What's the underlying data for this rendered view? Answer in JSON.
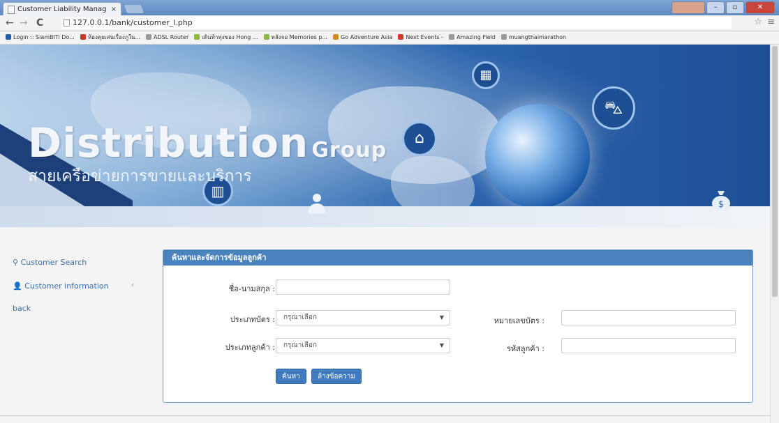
{
  "browser": {
    "tab_title": "Customer Liability Manag",
    "tab_close": "×",
    "url": "127.0.0.1/bank/customer_l.php",
    "bookmarks": [
      {
        "label": "Login :: SiamBITi Do...",
        "color": "#2a5db0"
      },
      {
        "label": "ห้องคุยเล่นเรื่องภูใน...",
        "color": "#c0392b"
      },
      {
        "label": "ADSL Router",
        "color": "#999999"
      },
      {
        "label": "เดินท้าทุ่งของ Hong ...",
        "color": "#8ab73c"
      },
      {
        "label": "หลังจอ Memories p...",
        "color": "#8ab73c"
      },
      {
        "label": "Go Adventure Asia",
        "color": "#d68a1c"
      },
      {
        "label": "Next Events -",
        "color": "#d63a2a"
      },
      {
        "label": "Amazing Field",
        "color": "#999999"
      },
      {
        "label": "muangthaimarathon",
        "color": "#999999"
      }
    ]
  },
  "banner": {
    "title": "Distribution",
    "title_suffix": "Group",
    "subtitle": "สายเครือข่ายการขายและบริการ"
  },
  "sidebar": {
    "items": [
      {
        "label": "Customer Search",
        "icon": "search-icon"
      },
      {
        "label": "Customer information",
        "icon": "user-icon"
      },
      {
        "label": "back"
      }
    ]
  },
  "panel": {
    "title": "ค้นหาและจัดการข้อมูลลูกค้า",
    "fields": {
      "name_label": "ชื่อ-นามสกุล :",
      "card_type_label": "ประเภทบัตร :",
      "card_type_value": "กรุณาเลือก",
      "card_no_label": "หมายเลขบัตร :",
      "customer_type_label": "ประเภทลูกค้า :",
      "customer_type_value": "กรุณาเลือก",
      "customer_code_label": "รหัสลูกค้า :"
    },
    "buttons": {
      "search": "ค้นหา",
      "clear": "ล้างข้อความ"
    }
  },
  "colors": {
    "accent": "#4a82bd",
    "link": "#3a6ea5"
  }
}
